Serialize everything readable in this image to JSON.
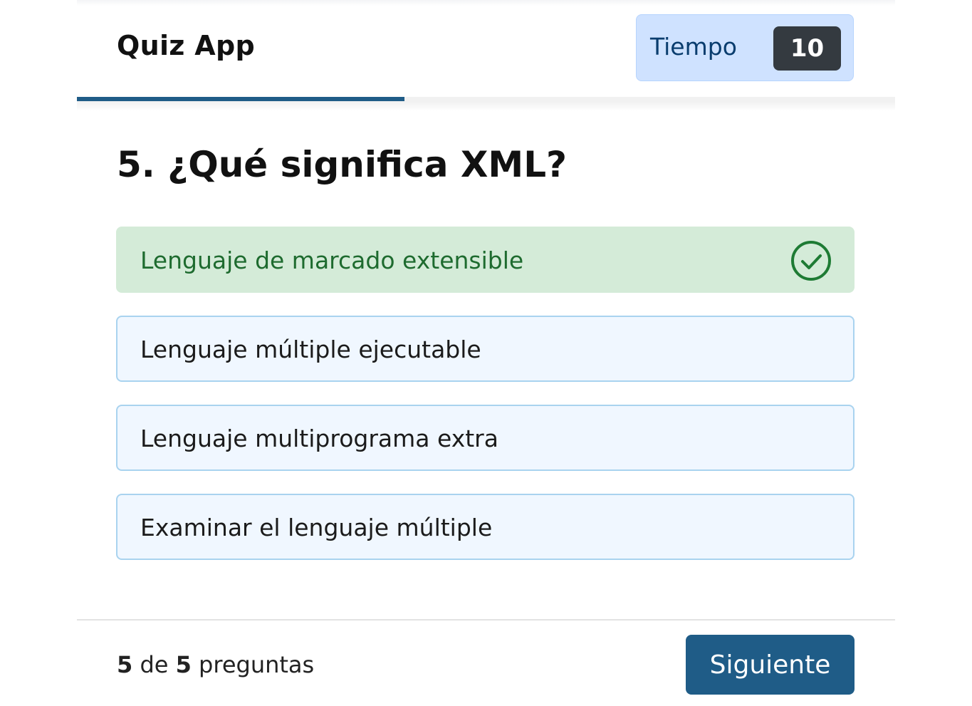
{
  "header": {
    "title": "Quiz App",
    "timer_label": "Tiempo",
    "timer_value": "10",
    "progress": 0.4
  },
  "question": {
    "text": "5. ¿Qué significa XML?"
  },
  "options": [
    {
      "label": "Lenguaje de marcado extensible",
      "state": "correct",
      "icon": "check-circle-icon"
    },
    {
      "label": "Lenguaje múltiple ejecutable",
      "state": "default"
    },
    {
      "label": "Lenguaje multiprograma extra",
      "state": "default"
    },
    {
      "label": "Examinar el lenguaje múltiple",
      "state": "default"
    }
  ],
  "footer": {
    "current": "5",
    "of_text": "de",
    "total": "5",
    "suffix": "preguntas",
    "next_label": "Siguiente"
  },
  "colors": {
    "accent": "#1f5c87",
    "correct_bg": "#d4ebd8",
    "correct_text": "#1e6b2f",
    "option_bg": "#f0f7ff",
    "option_border": "#a9d3ef",
    "timer_bg": "#cfe2ff",
    "timer_value_bg": "#343a40"
  }
}
